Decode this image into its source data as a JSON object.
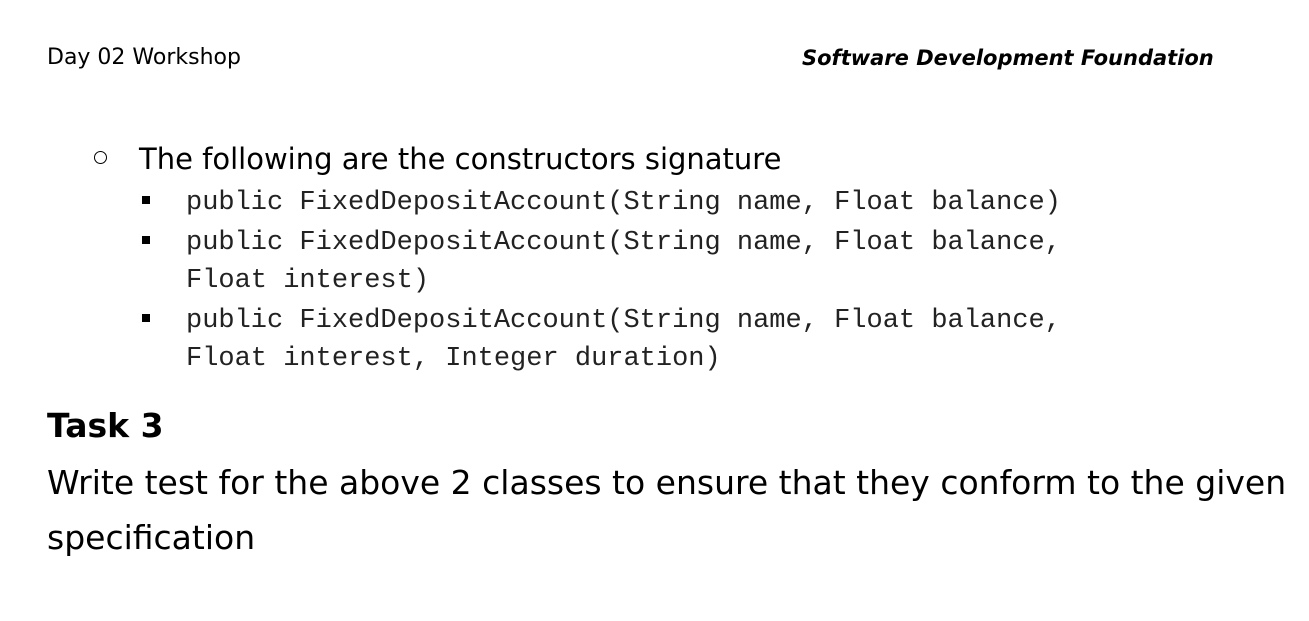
{
  "header": {
    "left": "Day 02 Workshop",
    "right": "Software Development Foundation"
  },
  "intro": "The following are the constructors signature",
  "constructors": [
    "public FixedDepositAccount(String name, Float balance)",
    "public FixedDepositAccount(String name, Float balance,\nFloat interest)",
    "public FixedDepositAccount(String name, Float balance,\nFloat interest, Integer duration)"
  ],
  "task": {
    "title": "Task 3",
    "description": "Write test for the above 2 classes to ensure that they conform to the given specification"
  }
}
